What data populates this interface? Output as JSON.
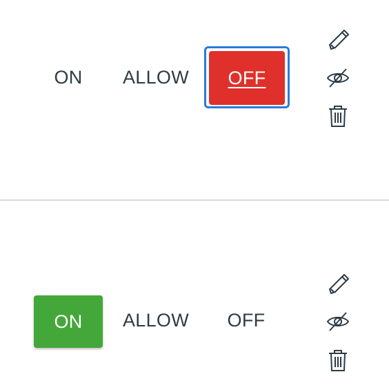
{
  "rows": [
    {
      "options": [
        {
          "label": "ON"
        },
        {
          "label": "ALLOW"
        },
        {
          "label": "OFF"
        }
      ],
      "selected": "OFF",
      "selected_color": "#e0302b",
      "focused": true,
      "actions": [
        "pencil-icon",
        "eye-slash-icon",
        "trash-icon"
      ]
    },
    {
      "options": [
        {
          "label": "ON"
        },
        {
          "label": "ALLOW"
        },
        {
          "label": "OFF"
        }
      ],
      "selected": "ON",
      "selected_color": "#44a73a",
      "focused": false,
      "actions": [
        "pencil-icon",
        "eye-slash-icon",
        "trash-icon"
      ]
    }
  ],
  "colors": {
    "text": "#2d3b45",
    "focus_ring": "#2b7bd6",
    "divider": "#d9d9d9"
  }
}
